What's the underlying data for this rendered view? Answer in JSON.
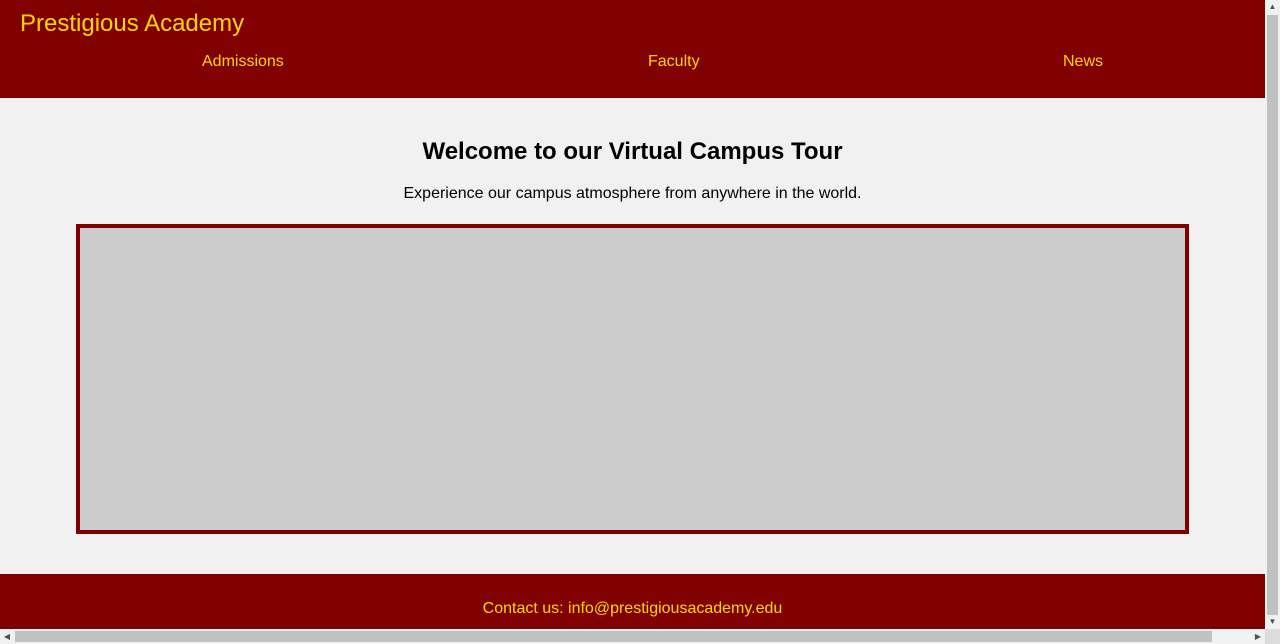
{
  "header": {
    "brand": "Prestigious Academy",
    "nav": {
      "admissions": "Admissions",
      "faculty": "Faculty",
      "news": "News"
    }
  },
  "main": {
    "title": "Welcome to our Virtual Campus Tour",
    "subtitle": "Experience our campus atmosphere from anywhere in the world."
  },
  "footer": {
    "contact": "Contact us: info@prestigiousacademy.edu"
  },
  "colors": {
    "primary": "#800000",
    "accent": "#ffd700",
    "background": "#f1f1f1",
    "tour_placeholder": "#cccccc"
  },
  "icons": {
    "scroll_up": "triangle-up-icon",
    "scroll_down": "triangle-down-icon",
    "scroll_left": "triangle-left-icon",
    "scroll_right": "triangle-right-icon"
  }
}
